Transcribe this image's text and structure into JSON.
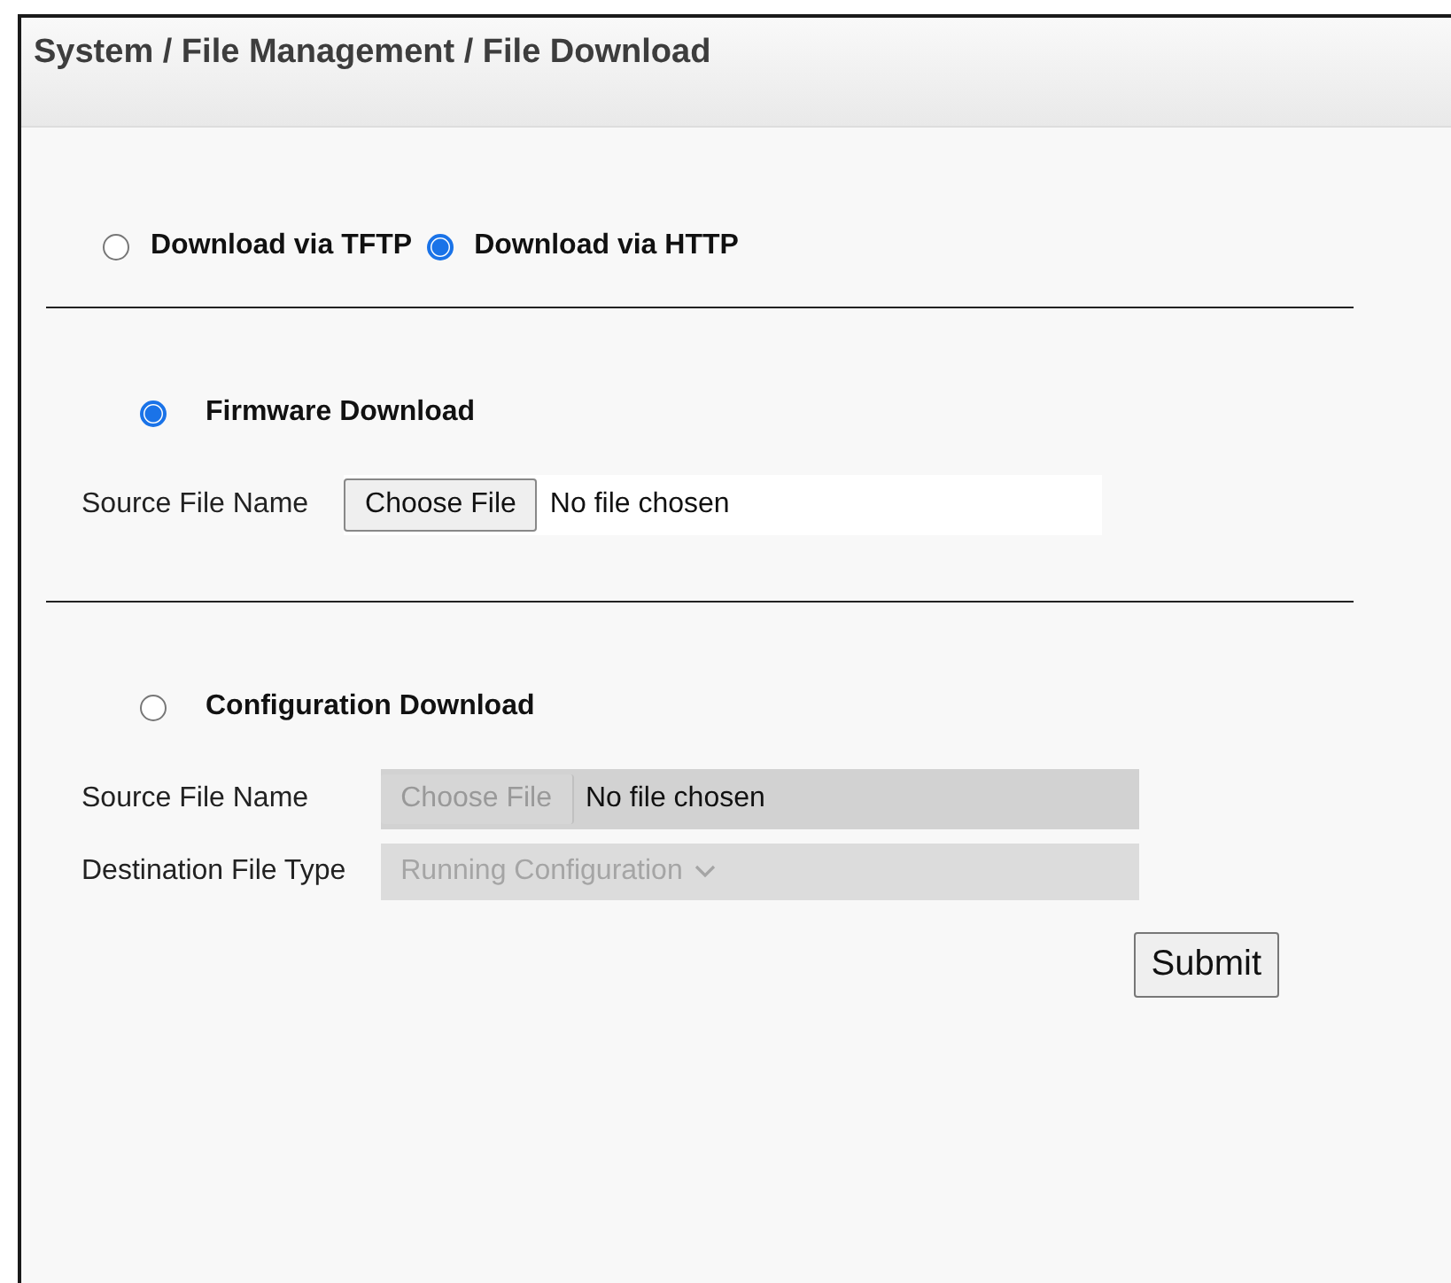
{
  "header": {
    "title": "System / File Management / File Download"
  },
  "protocols": [
    {
      "label": "Download via TFTP",
      "selected": false
    },
    {
      "label": "Download via HTTP",
      "selected": true
    }
  ],
  "sections": [
    {
      "title": "Firmware Download",
      "selected": true,
      "disabled": false,
      "fields": [
        {
          "kind": "file",
          "label": "Source File Name",
          "button": "Choose File",
          "value": "No file chosen"
        }
      ]
    },
    {
      "title": "Configuration Download",
      "selected": false,
      "disabled": true,
      "fields": [
        {
          "kind": "file",
          "label": "Source File Name",
          "button": "Choose File",
          "value": "No file chosen"
        },
        {
          "kind": "select",
          "label": "Destination File Type",
          "value": "Running Configuration"
        }
      ]
    }
  ],
  "submit": "Submit"
}
